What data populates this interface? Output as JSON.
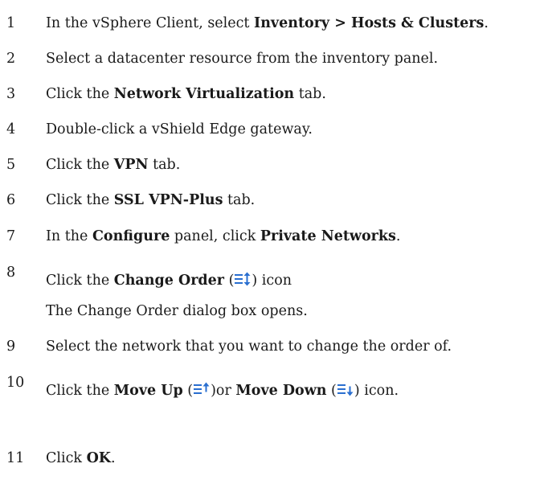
{
  "steps": [
    {
      "num": "1",
      "parts": [
        "In the vSphere Client, select ",
        "Inventory > Hosts & Clusters",
        "."
      ]
    },
    {
      "num": "2",
      "parts": [
        "Select a datacenter resource from the inventory panel."
      ]
    },
    {
      "num": "3",
      "parts": [
        "Click the ",
        "Network Virtualization",
        " tab."
      ]
    },
    {
      "num": "4",
      "parts": [
        "Double-click a vShield Edge gateway."
      ]
    },
    {
      "num": "5",
      "parts": [
        "Click the ",
        "VPN",
        " tab."
      ]
    },
    {
      "num": "6",
      "parts": [
        "Click the ",
        "SSL VPN-Plus",
        " tab."
      ]
    },
    {
      "num": "7",
      "parts": [
        "In the ",
        "Configure",
        " panel, click ",
        "Private Networks",
        "."
      ]
    },
    {
      "num": "8",
      "parts": [
        "Click the ",
        "Change Order",
        " (",
        ") icon"
      ],
      "note": "The Change Order dialog box opens."
    },
    {
      "num": "9",
      "parts": [
        "Select the network that you want to change the order of."
      ]
    },
    {
      "num": "10",
      "parts": [
        "Click the ",
        "Move Up",
        " (",
        ")or ",
        "Move Down",
        " (",
        ") icon."
      ]
    },
    {
      "num": "11",
      "parts": [
        "Click ",
        "OK",
        "."
      ]
    }
  ],
  "icons": {
    "change_order": "change-order-icon",
    "move_up": "move-up-icon",
    "move_down": "move-down-icon",
    "accent": "#2a6fd0"
  }
}
